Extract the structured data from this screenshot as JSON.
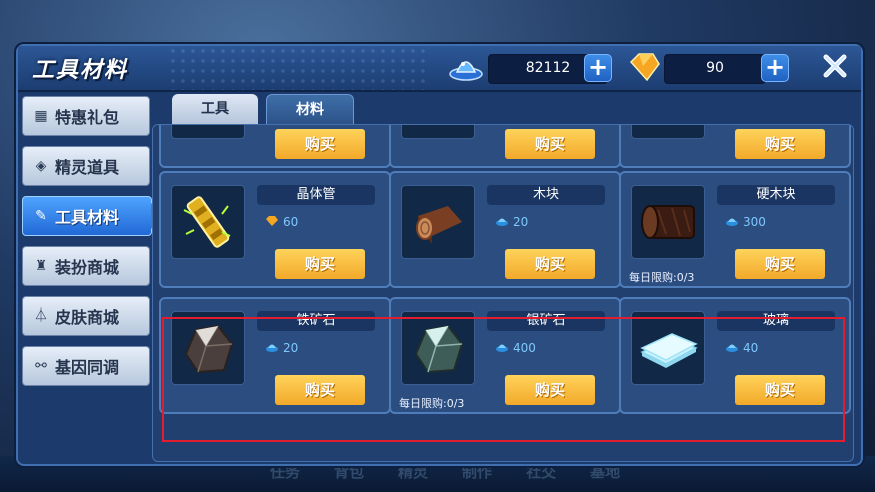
{
  "window": {
    "title": "工具材料"
  },
  "currencies": [
    {
      "name": "gem-currency",
      "value": "82112"
    },
    {
      "name": "crystal-currency",
      "value": "90"
    }
  ],
  "bottom_nav": [
    "任务",
    "背包",
    "精灵",
    "制作",
    "社交",
    "基地"
  ],
  "sidebar": {
    "items": [
      {
        "label": "特惠礼包",
        "icon": "gift-icon"
      },
      {
        "label": "精灵道具",
        "icon": "cube-icon"
      },
      {
        "label": "工具材料",
        "icon": "wrench-icon",
        "active": true
      },
      {
        "label": "装扮商城",
        "icon": "shirt-icon"
      },
      {
        "label": "皮肤商城",
        "icon": "hanger-icon"
      },
      {
        "label": "基因同调",
        "icon": "dna-icon"
      }
    ]
  },
  "tabs": [
    {
      "label": "工具",
      "active": false
    },
    {
      "label": "材料",
      "active": true
    }
  ],
  "buy_label": "购买",
  "items": [
    {
      "name": "晶体管",
      "price": "60",
      "currency": "crystal",
      "limit": ""
    },
    {
      "name": "木块",
      "price": "20",
      "currency": "gem",
      "limit": ""
    },
    {
      "name": "硬木块",
      "price": "300",
      "currency": "gem",
      "limit": "每日限购:0/3"
    },
    {
      "name": "铁矿石",
      "price": "20",
      "currency": "gem",
      "limit": ""
    },
    {
      "name": "银矿石",
      "price": "400",
      "currency": "gem",
      "limit": "每日限购:0/3"
    },
    {
      "name": "玻璃",
      "price": "40",
      "currency": "gem",
      "limit": ""
    }
  ],
  "colors": {
    "buy": "#f2a92a",
    "highlight": "#e11d2f",
    "price": "#7fc8ff"
  }
}
